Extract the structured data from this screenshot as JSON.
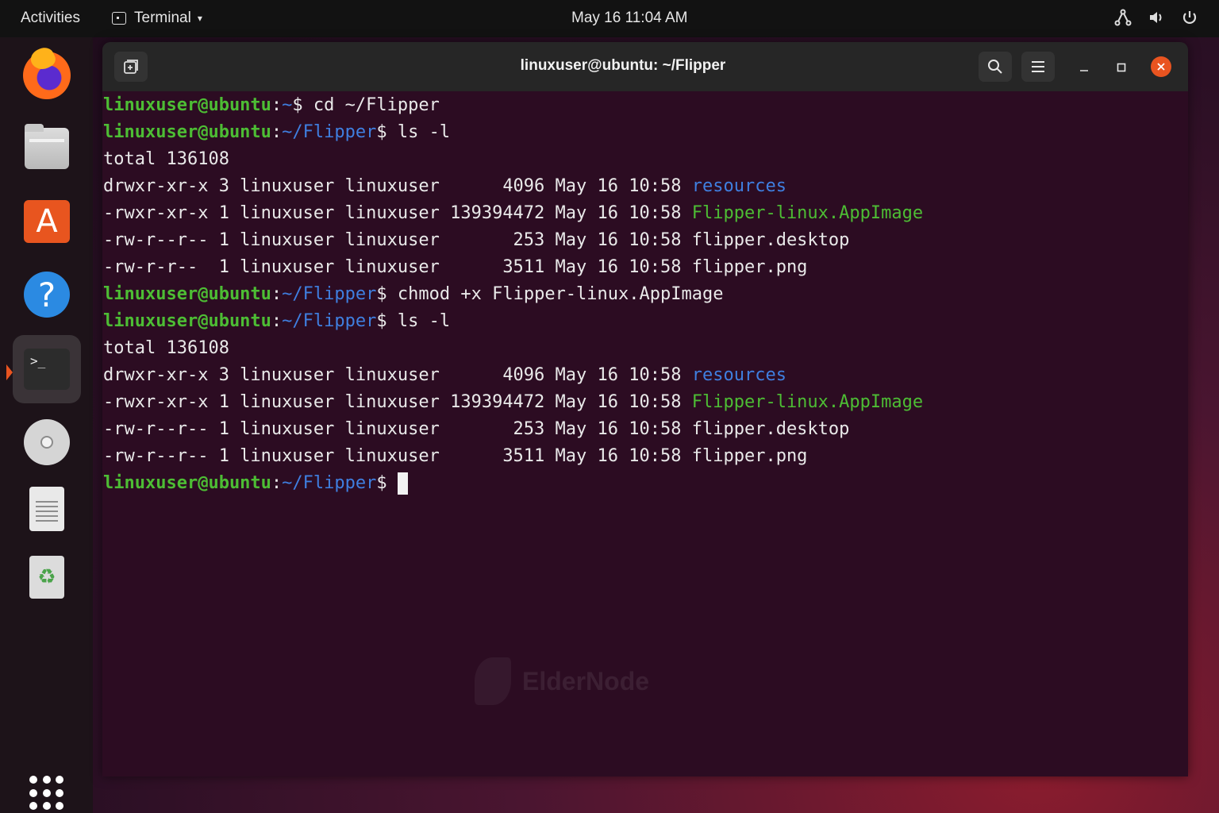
{
  "topbar": {
    "activities": "Activities",
    "app_name": "Terminal",
    "clock": "May 16  11:04 AM",
    "tray_icons": [
      "network-icon",
      "volume-icon",
      "power-icon"
    ]
  },
  "dock": {
    "items": [
      "firefox",
      "files",
      "software",
      "help",
      "terminal",
      "disc",
      "text-editor",
      "trash"
    ],
    "active": "terminal"
  },
  "window": {
    "title": "linuxuser@ubuntu: ~/Flipper",
    "accent": "#e95420"
  },
  "terminal": {
    "l1": {
      "user": "linuxuser@ubuntu",
      "colon": ":",
      "path": "~",
      "dollar": "$",
      "cmd": " cd ~/Flipper"
    },
    "l2": {
      "user": "linuxuser@ubuntu",
      "colon": ":",
      "path": "~/Flipper",
      "dollar": "$",
      "cmd": " ls -l"
    },
    "l3": "total 136108",
    "l4": {
      "meta": "drwxr-xr-x 3 linuxuser linuxuser      4096 May 16 10:58 ",
      "name": "resources"
    },
    "l5": {
      "meta": "-rwxr-xr-x 1 linuxuser linuxuser 139394472 May 16 10:58 ",
      "name": "Flipper-linux.AppImage"
    },
    "l6": {
      "meta": "-rw-r--r-- 1 linuxuser linuxuser       253 May 16 10:58 ",
      "name": "flipper.desktop"
    },
    "l7": {
      "meta": "-rw-r-r--  1 linuxuser linuxuser      3511 May 16 10:58 ",
      "name": "flipper.png"
    },
    "l8": {
      "user": "linuxuser@ubuntu",
      "colon": ":",
      "path": "~/Flipper",
      "dollar": "$",
      "cmd": " chmod +x Flipper-linux.AppImage"
    },
    "l9": {
      "user": "linuxuser@ubuntu",
      "colon": ":",
      "path": "~/Flipper",
      "dollar": "$",
      "cmd": " ls -l"
    },
    "l10": "total 136108",
    "l11": {
      "meta": "drwxr-xr-x 3 linuxuser linuxuser      4096 May 16 10:58 ",
      "name": "resources"
    },
    "l12": {
      "meta": "-rwxr-xr-x 1 linuxuser linuxuser 139394472 May 16 10:58 ",
      "name": "Flipper-linux.AppImage"
    },
    "l13": {
      "meta": "-rw-r--r-- 1 linuxuser linuxuser       253 May 16 10:58 ",
      "name": "flipper.desktop"
    },
    "l14": {
      "meta": "-rw-r--r-- 1 linuxuser linuxuser      3511 May 16 10:58 ",
      "name": "flipper.png"
    },
    "l15": {
      "user": "linuxuser@ubuntu",
      "colon": ":",
      "path": "~/Flipper",
      "dollar": "$",
      "cmd": " "
    }
  },
  "watermark": "ElderNode"
}
